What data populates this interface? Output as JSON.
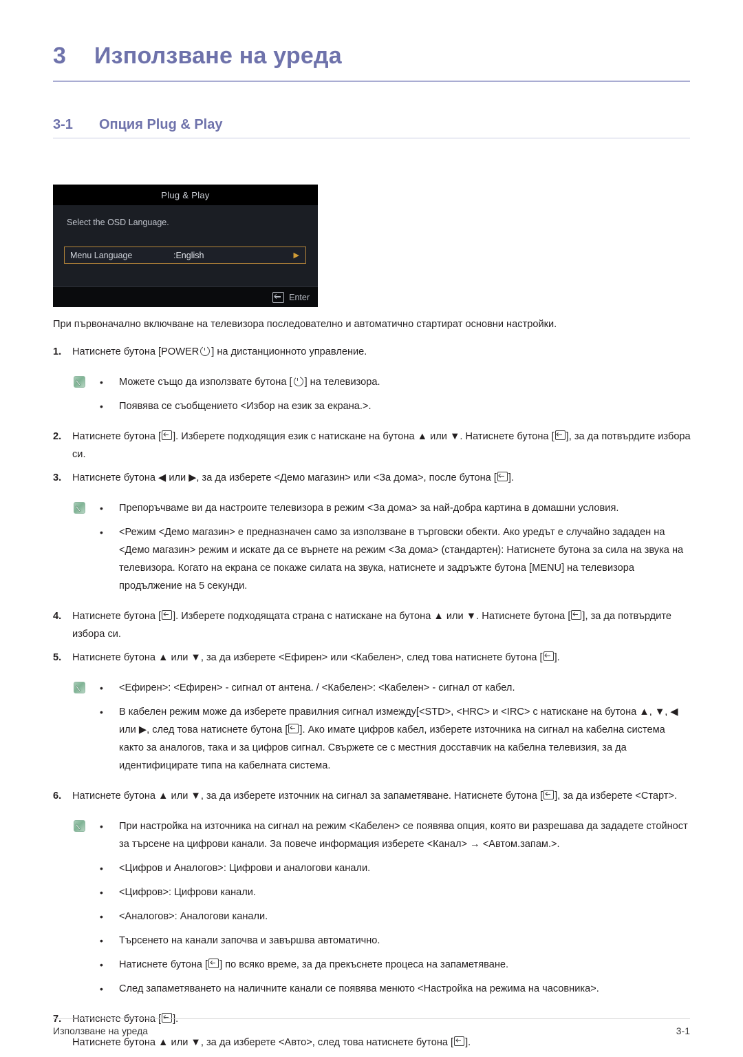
{
  "chapter": {
    "number": "3",
    "title": "Използване на уреда"
  },
  "section": {
    "number": "3-1",
    "title": "Опция Plug & Play"
  },
  "osd": {
    "title": "Plug & Play",
    "prompt": "Select the OSD Language.",
    "row_label": "Menu Language",
    "row_value": ":English",
    "row_arrow": "▶",
    "footer_label": "Enter",
    "highlight_color": "#b8873a"
  },
  "intro": "При първоначално включване на телевизора последователно и автоматично стартират основни настройки.",
  "steps": {
    "s1_marker": "1.",
    "s1_a": "Натиснете бутона [POWER",
    "s1_b": "] на дистанционното управление.",
    "note1_b1_a": "Можете също да използвате бутона [",
    "note1_b1_b": "] на телевизора.",
    "note1_b2": "Появява се съобщението <Избор на език за екрана.>.",
    "s2_marker": "2.",
    "s2_a": "Натиснете бутона [",
    "s2_b": "]. Изберете подходящия език с натискане на бутона ▲ или ▼. Натиснете бутона [",
    "s2_c": "], за да потвърдите избора си.",
    "s3_marker": "3.",
    "s3_a": "Натиснете бутона ◀ или ▶, за да изберете <Демо магазин> или <За дома>, после бутона [",
    "s3_b": "].",
    "note2_b1": "Препоръчваме ви да настроите телевизора в режим <За дома> за най-добра картина в домашни условия.",
    "note2_b2": "<Режим <Демо магазин> е предназначен само за използване в търговски обекти. Ако уредът е случайно зададен на <Демо магазин> режим и искате да се върнете на режим <За дома> (стандартен): Натиснете бутона за сила на звука на телевизора. Когато на екрана се покаже силата на звука, натиснете и задръжте бутона [MENU] на телевизора продължение на 5 секунди.",
    "s4_marker": "4.",
    "s4_a": "Натиснете бутона [",
    "s4_b": "]. Изберете подходящата страна с натискане на бутона ▲ или ▼. Натиснете бутона [",
    "s4_c": "], за да потвърдите избора си.",
    "s5_marker": "5.",
    "s5_a": "Натиснете бутона ▲ или ▼, за да изберете <Ефирен> или <Кабелен>, след това натиснете бутона [",
    "s5_b": "].",
    "note3_b1": "<Ефирен>: <Ефирен> - сигнал от антена. / <Кабелен>: <Кабелен> - сигнал от кабел.",
    "note3_b2_a": "В кабелен режим може да изберете правилния сигнал измежду[<STD>, <HRC> и <IRC> с натискане на бутона ▲, ▼, ◀ или ▶, след това натиснете бутона [",
    "note3_b2_b": "]. Ако имате цифров кабел, изберете източника на сигнал на кабелна система както за аналогов, така и за цифров сигнал. Свържете се с местния досставчик на кабелна телевизия, за да идентифицирате типа на кабелната система.",
    "s6_marker": "6.",
    "s6_a": "Натиснете бутона ▲ или ▼, за да изберете източник на сигнал за запаметяване. Натиснете бутона [",
    "s6_b": "], за да изберете <Старт>.",
    "note4_b1": "При настройка на източника на сигнал на режим <Кабелен> се появява опция, която ви разрешава да зададете стойност за търсене на цифрови канали. За повече информация изберете <Канал> → <Автом.запам.>.",
    "note4_b2": "<Цифров и Аналогов>: Цифрови и аналогови канали.",
    "note4_b3": "<Цифров>: Цифрови канали.",
    "note4_b4": "<Аналогов>: Аналогови канали.",
    "note4_b5": "Търсенето на канали започва и завършва автоматично.",
    "note4_b6_a": "Натиснете бутона [",
    "note4_b6_b": "] по всяко време, за да прекъснете процеса на запаметяване.",
    "note4_b7": "След запаметяването на наличните канали се появява менюто <Настройка на режима на часовника>.",
    "s7_marker": "7.",
    "s7_a": "Натиснете бутона [",
    "s7_b": "].",
    "s7_sub_a": "Натиснете бутона ▲ или ▼, за да изберете <Авто>, след това натиснете бутона [",
    "s7_sub_b": "]."
  },
  "bullet_char": "•",
  "footer": {
    "left": "Използване на уреда",
    "right": "3-1"
  }
}
